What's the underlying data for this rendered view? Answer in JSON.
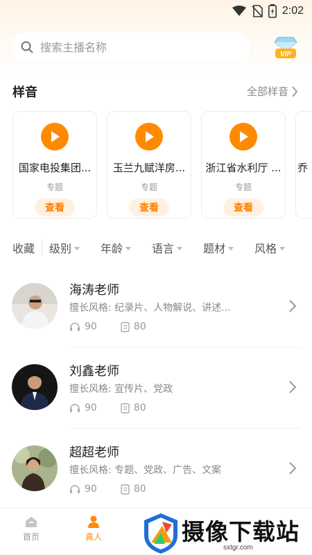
{
  "status_bar": {
    "time": "2:02"
  },
  "search": {
    "placeholder": "搜索主播名称"
  },
  "samples": {
    "title": "样音",
    "more_label": "全部样音",
    "cards": [
      {
        "title": "国家电投集团...",
        "tag": "专题",
        "button": "查看"
      },
      {
        "title": "玉兰九赋洋房...",
        "tag": "专题",
        "button": "查看"
      },
      {
        "title": "浙江省水利厅 ...",
        "tag": "专题",
        "button": "查看"
      },
      {
        "title": "乔",
        "tag": "",
        "button": ""
      }
    ]
  },
  "filters": {
    "first": "收藏",
    "items": [
      "级别",
      "年龄",
      "语言",
      "题材",
      "风格"
    ]
  },
  "anchors": [
    {
      "name": "海涛老师",
      "style": "擅长风格:  纪录片、人物解说、讲述...",
      "listens": "90",
      "works": "80"
    },
    {
      "name": "刘鑫老师",
      "style": "擅长风格:  宣传片、党政",
      "listens": "90",
      "works": "80"
    },
    {
      "name": "超超老师",
      "style": "擅长风格:  专题、党政、广告、文案",
      "listens": "90",
      "works": "80"
    }
  ],
  "tabs": [
    {
      "label": "首页",
      "active": false
    },
    {
      "label": "真人",
      "active": true
    }
  ],
  "watermark": {
    "text": "摄像下载站",
    "url": "sxtgr.com"
  },
  "colors": {
    "accent": "#ff8a00",
    "active_tab": "#ff8a00"
  }
}
